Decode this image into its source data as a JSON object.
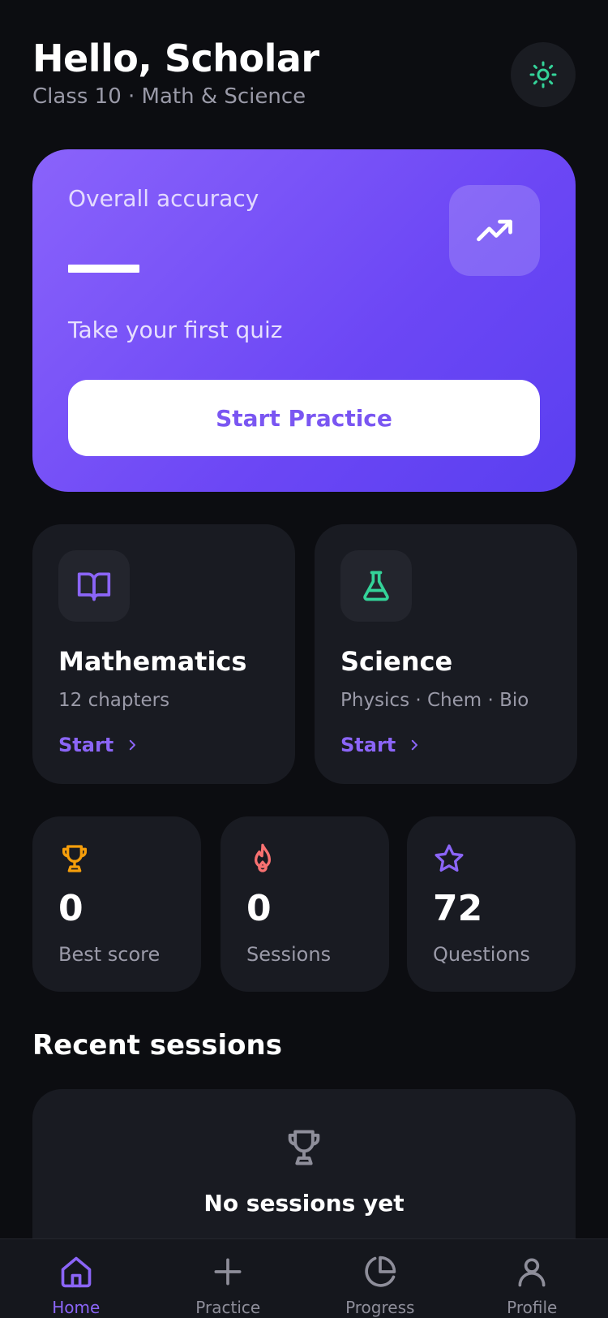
{
  "header": {
    "greeting": "Hello, Scholar",
    "subtitle": "Class 10 · Math & Science",
    "theme_icon": "sun-icon"
  },
  "hero": {
    "label": "Overall accuracy",
    "value": "—",
    "hint": "Take your first quiz",
    "icon": "trending-up-icon",
    "button_label": "Start Practice"
  },
  "subjects": [
    {
      "title": "Mathematics",
      "subtitle": "12 chapters",
      "link_label": "Start",
      "icon": "book-open-icon",
      "icon_color": "#8b65f7"
    },
    {
      "title": "Science",
      "subtitle": "Physics · Chem · Bio",
      "link_label": "Start",
      "icon": "flask-icon",
      "icon_color": "#34d399"
    }
  ],
  "stats": [
    {
      "value": "0",
      "label": "Best score",
      "icon": "trophy-icon",
      "icon_color": "#f59e0b"
    },
    {
      "value": "0",
      "label": "Sessions",
      "icon": "flame-icon",
      "icon_color": "#f87171"
    },
    {
      "value": "72",
      "label": "Questions",
      "icon": "star-icon",
      "icon_color": "#8b65f7"
    }
  ],
  "recent": {
    "title": "Recent sessions",
    "empty_title": "No sessions yet",
    "empty_icon": "trophy-icon"
  },
  "nav": [
    {
      "label": "Home",
      "icon": "home-icon",
      "active": true
    },
    {
      "label": "Practice",
      "icon": "plus-icon",
      "active": false
    },
    {
      "label": "Progress",
      "icon": "pie-chart-icon",
      "active": false
    },
    {
      "label": "Profile",
      "icon": "user-icon",
      "active": false
    }
  ],
  "colors": {
    "background": "#0c0d11",
    "card": "#191b22",
    "accent": "#8b65f7",
    "hero_gradient_start": "#8a63fb",
    "hero_gradient_end": "#5a3ff0"
  }
}
